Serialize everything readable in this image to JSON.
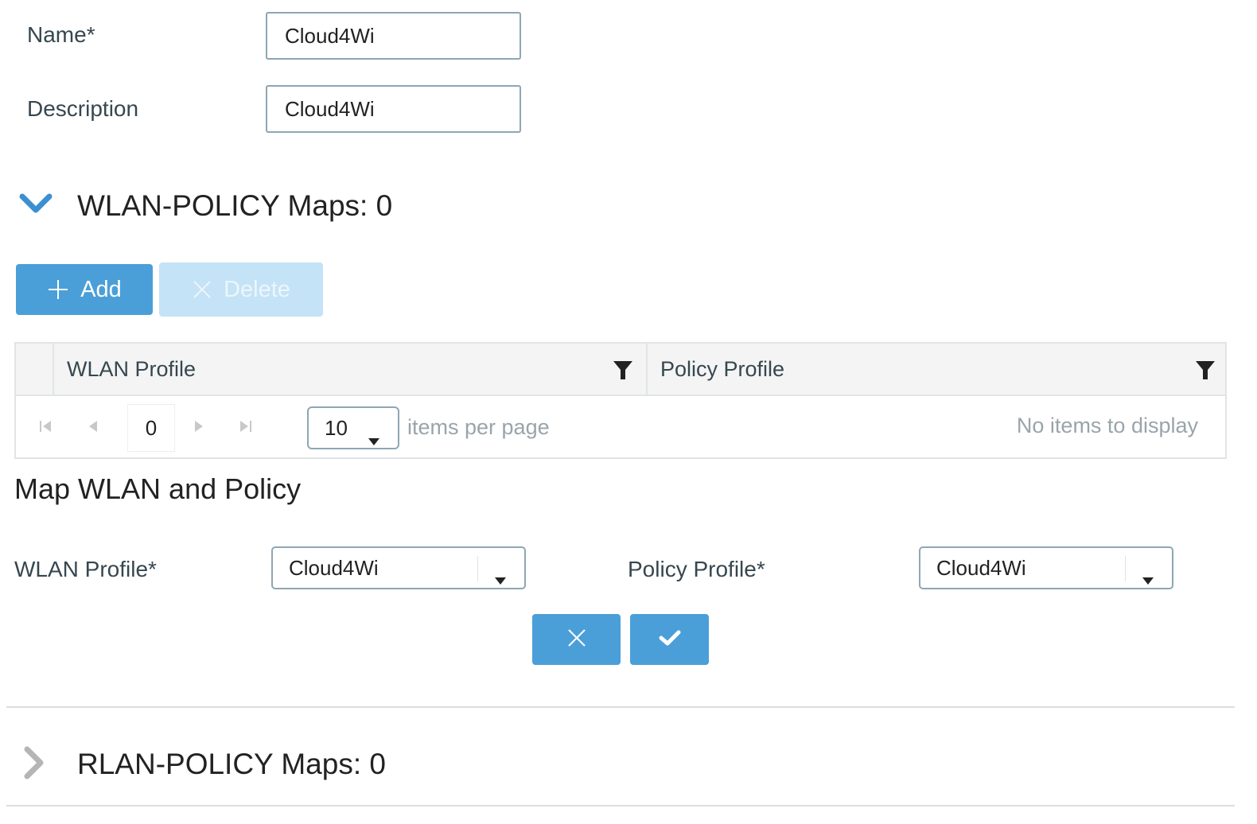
{
  "form": {
    "name_label": "Name*",
    "name_value": "Cloud4Wi",
    "description_label": "Description",
    "description_value": "Cloud4Wi"
  },
  "wlan_section": {
    "title": "WLAN-POLICY Maps: 0",
    "expanded": true,
    "add_label": "Add",
    "delete_label": "Delete",
    "columns": [
      "WLAN Profile",
      "Policy Profile"
    ],
    "pager": {
      "page": "0",
      "page_size": "10",
      "items_per_page_label": "items per page",
      "empty_message": "No items to display"
    }
  },
  "map_section": {
    "title": "Map WLAN and Policy",
    "wlan_label": "WLAN Profile*",
    "wlan_value": "Cloud4Wi",
    "policy_label": "Policy Profile*",
    "policy_value": "Cloud4Wi"
  },
  "rlan_section": {
    "title": "RLAN-POLICY Maps: 0",
    "expanded": false
  },
  "colors": {
    "primary": "#4a9fd8",
    "primary_disabled": "#c5e3f6",
    "chevron_active": "#3d8fd0",
    "chevron_inactive": "#b5b5b5"
  },
  "icons": {
    "expand": "chevron-down-icon",
    "collapse": "chevron-right-icon",
    "add": "plus-icon",
    "delete": "close-icon",
    "filter": "filter-icon",
    "cancel": "close-icon",
    "confirm": "check-icon"
  }
}
